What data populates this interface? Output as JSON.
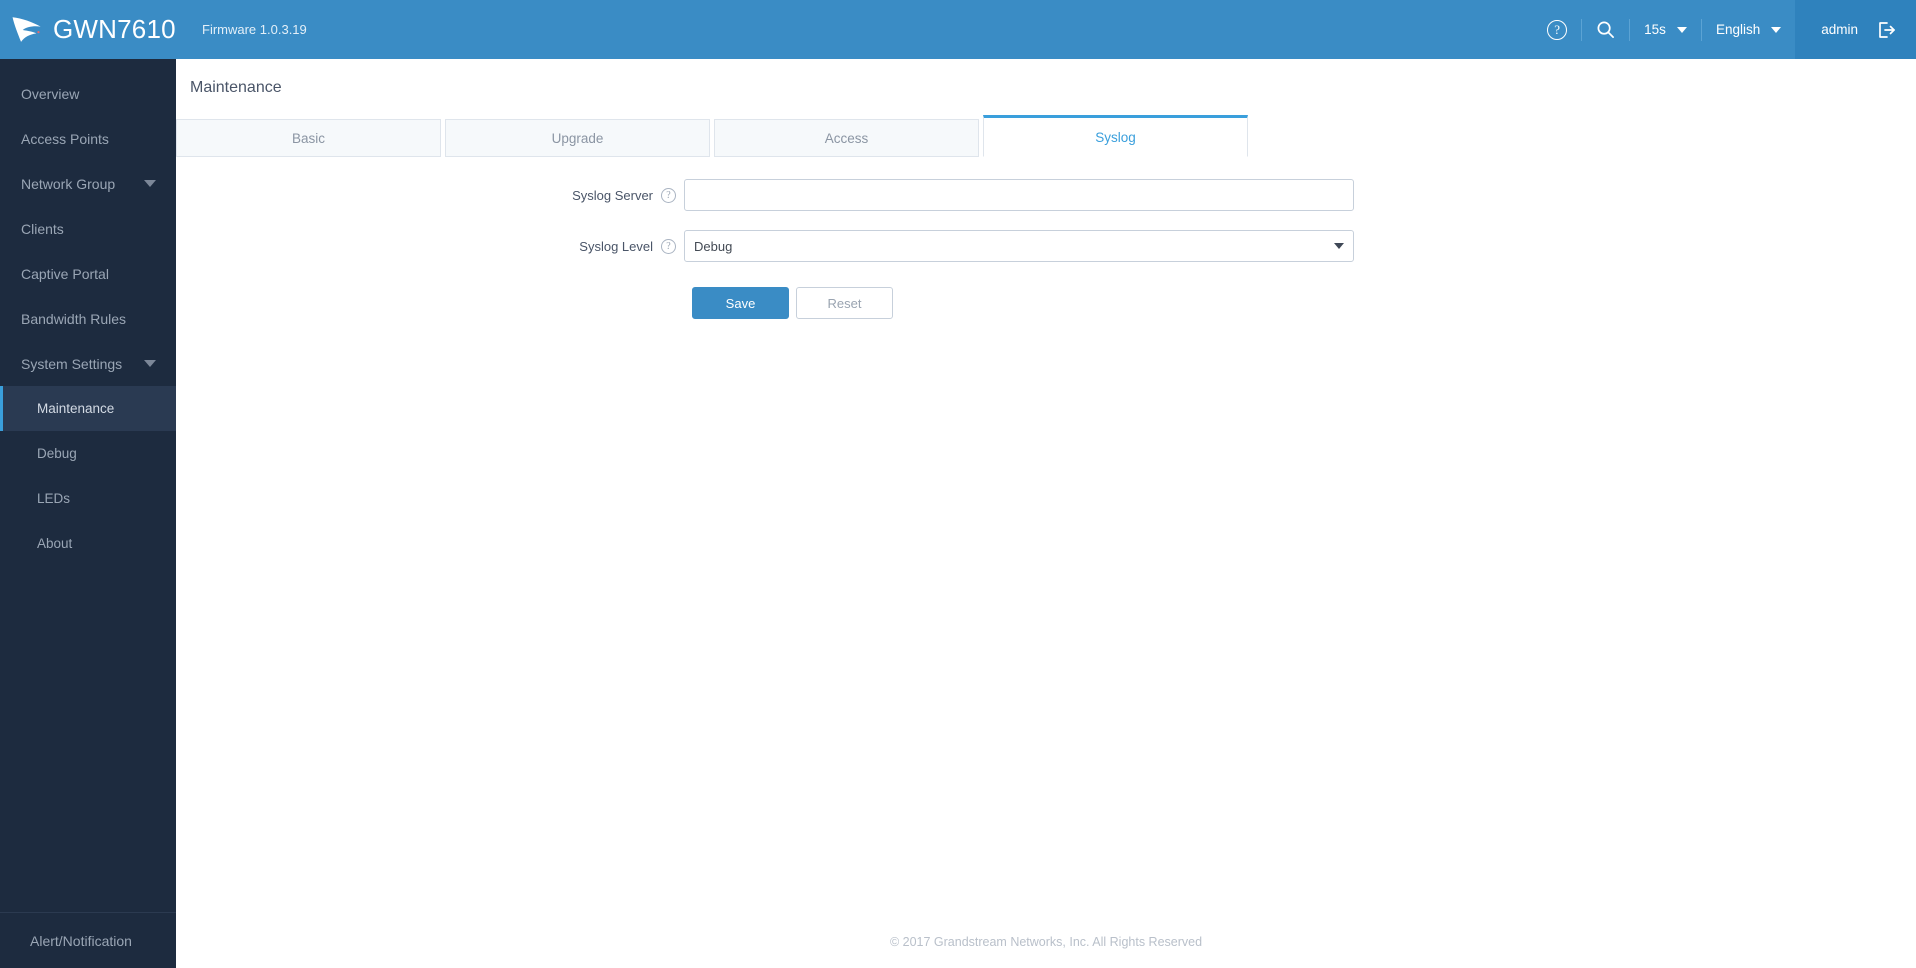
{
  "header": {
    "brand_name": "GWN7610",
    "firmware": "Firmware 1.0.3.19",
    "help_icon": "help-circle-icon",
    "help_glyph": "?",
    "search_icon": "search-icon",
    "refresh_interval": "15s",
    "language": "English",
    "user": "admin",
    "logout_icon": "logout-icon",
    "bg_color": "#3a8cc5",
    "user_bg_color": "#2f82bd"
  },
  "sidebar": {
    "bg_color": "#1d2b3f",
    "active_color": "#3a9fdc",
    "items": [
      {
        "label": "Overview",
        "sub": false,
        "active": false,
        "expandable": false
      },
      {
        "label": "Access Points",
        "sub": false,
        "active": false,
        "expandable": false
      },
      {
        "label": "Network Group",
        "sub": false,
        "active": false,
        "expandable": true
      },
      {
        "label": "Clients",
        "sub": false,
        "active": false,
        "expandable": false
      },
      {
        "label": "Captive Portal",
        "sub": false,
        "active": false,
        "expandable": false
      },
      {
        "label": "Bandwidth Rules",
        "sub": false,
        "active": false,
        "expandable": false
      },
      {
        "label": "System Settings",
        "sub": false,
        "active": false,
        "expandable": true
      },
      {
        "label": "Maintenance",
        "sub": true,
        "active": true,
        "expandable": false
      },
      {
        "label": "Debug",
        "sub": true,
        "active": false,
        "expandable": false
      },
      {
        "label": "LEDs",
        "sub": true,
        "active": false,
        "expandable": false
      },
      {
        "label": "About",
        "sub": true,
        "active": false,
        "expandable": false
      }
    ],
    "footer_label": "Alert/Notification"
  },
  "main": {
    "page_title": "Maintenance",
    "tabs": [
      {
        "label": "Basic",
        "active": false
      },
      {
        "label": "Upgrade",
        "active": false
      },
      {
        "label": "Access",
        "active": false
      },
      {
        "label": "Syslog",
        "active": true
      }
    ],
    "form": {
      "syslog_server": {
        "label": "Syslog Server",
        "help_glyph": "?",
        "value": "",
        "placeholder": ""
      },
      "syslog_level": {
        "label": "Syslog Level",
        "help_glyph": "?",
        "value": "Debug",
        "options": [
          "Debug"
        ]
      }
    },
    "buttons": {
      "save": "Save",
      "reset": "Reset"
    }
  },
  "footer": {
    "copyright": "© 2017 Grandstream Networks, Inc. All Rights Reserved"
  }
}
